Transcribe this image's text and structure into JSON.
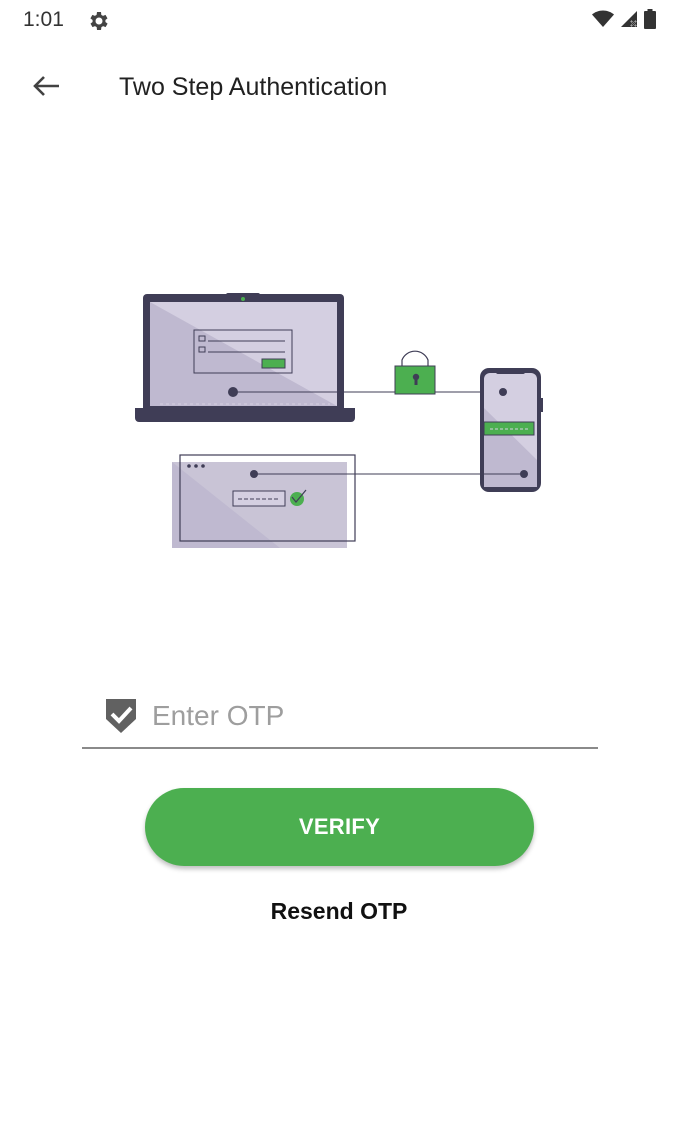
{
  "status_bar": {
    "time": "1:01",
    "icons": [
      "settings-gear-icon",
      "wifi-icon",
      "signal-icon",
      "battery-icon"
    ]
  },
  "app_bar": {
    "title": "Two Step Authentication",
    "back_icon": "arrow-back-icon"
  },
  "illustration": {
    "name": "two-step-authentication-illustration",
    "accent_color": "#4caf50",
    "device_color": "#3f3d56",
    "screen_color": "#d4cfe1"
  },
  "otp_field": {
    "placeholder": "Enter OTP",
    "value": "",
    "icon": "verified-shield-icon"
  },
  "verify_button": {
    "label": "VERIFY",
    "color": "#4caf50"
  },
  "resend": {
    "label": "Resend OTP"
  }
}
